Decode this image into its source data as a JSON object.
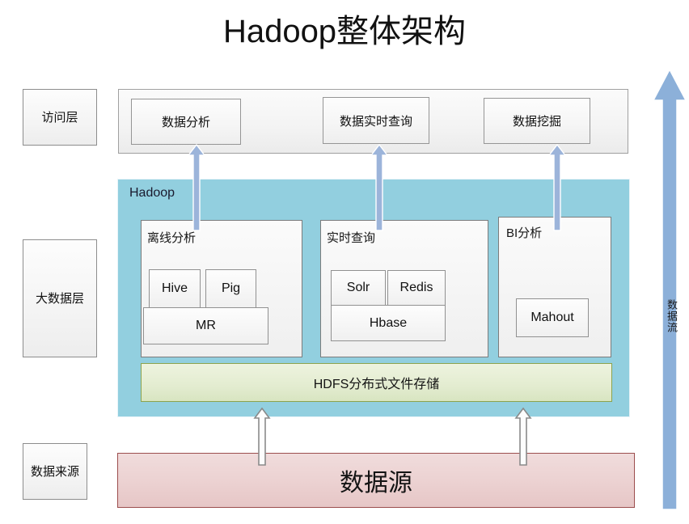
{
  "title": "Hadoop整体架构",
  "layers": [
    {
      "id": "access",
      "label": "访问层"
    },
    {
      "id": "bigdata",
      "label": "大数据层"
    },
    {
      "id": "source",
      "label": "数据来源"
    }
  ],
  "access_layer": {
    "items": [
      {
        "label": "数据分析"
      },
      {
        "label": "数据实时查询"
      },
      {
        "label": "数据挖掘"
      }
    ]
  },
  "hadoop": {
    "label": "Hadoop",
    "groups": [
      {
        "title": "离线分析",
        "components": [
          {
            "label": "Hive"
          },
          {
            "label": "Pig"
          },
          {
            "label": "MR"
          }
        ]
      },
      {
        "title": "实时查询",
        "components": [
          {
            "label": "Solr"
          },
          {
            "label": "Redis"
          },
          {
            "label": "Hbase"
          }
        ]
      },
      {
        "title": "BI分析",
        "components": [
          {
            "label": "Mahout"
          }
        ]
      }
    ],
    "storage": {
      "label": "HDFS分布式文件存储"
    }
  },
  "data_source": {
    "label": "数据源"
  },
  "data_flow": {
    "label": "数据流"
  },
  "colors": {
    "hadoop_container": "#92cfdf",
    "hdfs_fill": "#e3ecd0",
    "hdfs_border": "#8ca34e",
    "datasource_fill": "#ecd2d2",
    "datasource_border": "#9c4d4d",
    "flow_arrow": "#8cb0d9",
    "box_border": "#909090"
  }
}
